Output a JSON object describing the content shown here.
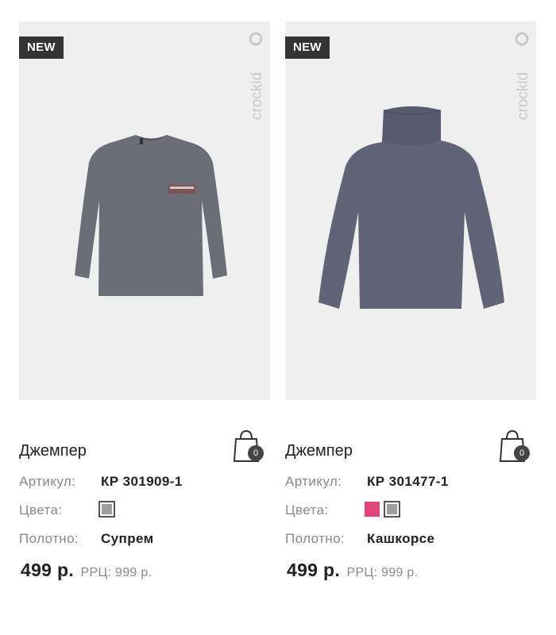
{
  "products": [
    {
      "badge": "NEW",
      "brand": "crockid",
      "title": "Джемпер",
      "cart_count": "0",
      "sku_label": "Артикул:",
      "sku": "КР 301909-1",
      "colors_label": "Цвета:",
      "colors": [
        "#9e9e9e"
      ],
      "fabric_label": "Полотно:",
      "fabric": "Супрем",
      "price": "499 р.",
      "rrp_label": "РРЦ: 999 р.",
      "garment_icon": "long-sleeve-tshirt",
      "garment_color": "#6b6d78"
    },
    {
      "badge": "NEW",
      "brand": "crockid",
      "title": "Джемпер",
      "cart_count": "0",
      "sku_label": "Артикул:",
      "sku": "КР 301477-1",
      "colors_label": "Цвета:",
      "colors": [
        "#e0457b",
        "#9e9e9e"
      ],
      "fabric_label": "Полотно:",
      "fabric": "Кашкорсе",
      "price": "499 р.",
      "rrp_label": "РРЦ: 999 р.",
      "garment_icon": "turtleneck",
      "garment_color": "#5f6577"
    }
  ]
}
